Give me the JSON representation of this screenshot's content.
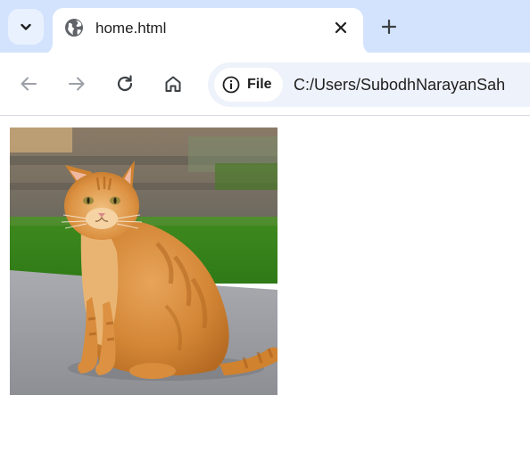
{
  "tab_strip": {
    "active_tab": {
      "title": "home.html",
      "icon": "globe-icon"
    },
    "tab_search_icon": "chevron-down-icon",
    "new_tab_icon": "plus-icon",
    "close_icon": "close-icon"
  },
  "toolbar": {
    "back_icon": "arrow-left-icon",
    "forward_icon": "arrow-right-icon",
    "reload_icon": "reload-icon",
    "home_icon": "home-icon",
    "site_chip": {
      "icon": "info-icon",
      "label": "File"
    },
    "url": "C:/Users/SubodhNarayanSah"
  },
  "page": {
    "image": {
      "subject": "orange tabby cat sitting on pavement"
    }
  },
  "colors": {
    "tab_strip_bg": "#d3e3fd",
    "omnibox_bg": "#eef2fa",
    "icon_dark": "#3c4043",
    "icon_disabled": "#9aa0a6"
  }
}
